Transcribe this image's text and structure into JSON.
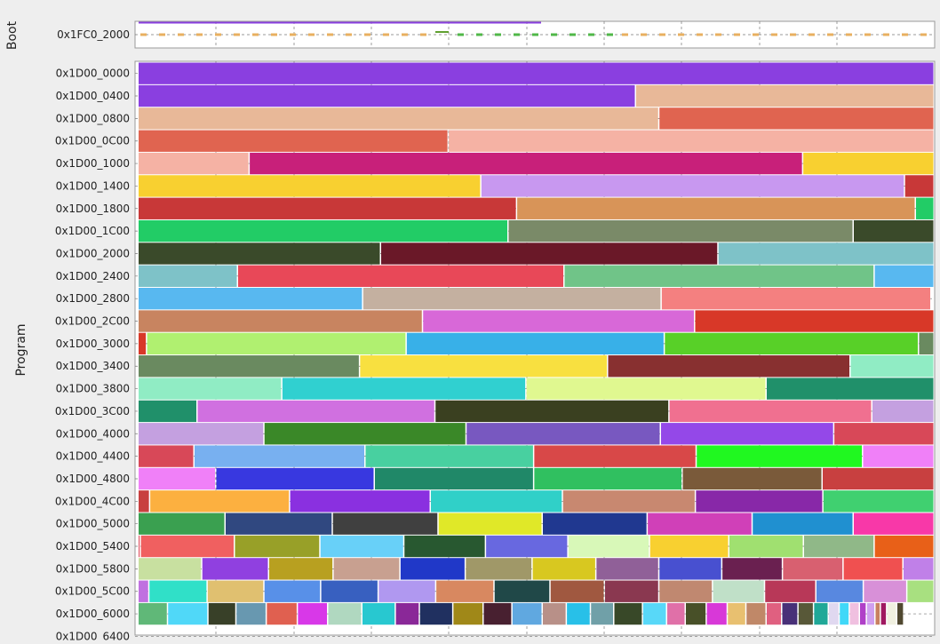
{
  "chart_data": {
    "type": "memory-map",
    "groups": [
      {
        "name": "Boot",
        "rows": [
          "0x1FC0_2000"
        ]
      },
      {
        "name": "Program",
        "rows": [
          "0x1D00_0000",
          "0x1D00_0400",
          "0x1D00_0800",
          "0x1D00_0C00",
          "0x1D00_1000",
          "0x1D00_1400",
          "0x1D00_1800",
          "0x1D00_1C00",
          "0x1D00_2000",
          "0x1D00_2400",
          "0x1D00_2800",
          "0x1D00_2C00",
          "0x1D00_3000",
          "0x1D00_3400",
          "0x1D00_3800",
          "0x1D00_3C00",
          "0x1D00_4000",
          "0x1D00_4400",
          "0x1D00_4800",
          "0x1D00_4C00",
          "0x1D00_5000",
          "0x1D00_5400",
          "0x1D00_5800",
          "0x1D00_5C00",
          "0x1D00_6000",
          "0x1D00_6400"
        ]
      }
    ],
    "row_span": 1024,
    "xlim": [
      0,
      1024
    ],
    "grid": true,
    "segments": [
      [
        [
          0,
          1024,
          "#8a3fe0"
        ]
      ],
      [
        [
          0,
          640,
          "#8a3fe0"
        ],
        [
          640,
          1024,
          "#e8b898"
        ]
      ],
      [
        [
          0,
          670,
          "#e8b898"
        ],
        [
          670,
          1024,
          "#e06450"
        ]
      ],
      [
        [
          0,
          399,
          "#e06450"
        ],
        [
          399,
          1024,
          "#f5b2a4"
        ]
      ],
      [
        [
          0,
          143,
          "#f5b2a4"
        ],
        [
          143,
          855,
          "#c8207a"
        ],
        [
          855,
          1024,
          "#f8d030"
        ]
      ],
      [
        [
          0,
          441,
          "#f8d030"
        ],
        [
          441,
          986,
          "#c898f0"
        ],
        [
          986,
          1024,
          "#c83838"
        ]
      ],
      [
        [
          0,
          487,
          "#c83838"
        ],
        [
          487,
          1000,
          "#d89458"
        ],
        [
          1000,
          1024,
          "#22cc66"
        ]
      ],
      [
        [
          0,
          476,
          "#22cc66"
        ],
        [
          476,
          920,
          "#7a8a68"
        ],
        [
          920,
          1024,
          "#3a4a2a"
        ]
      ],
      [
        [
          0,
          312,
          "#3a4a2a"
        ],
        [
          312,
          746,
          "#6a1828"
        ],
        [
          746,
          1024,
          "#7ec2c8"
        ]
      ],
      [
        [
          0,
          128,
          "#7ec2c8"
        ],
        [
          128,
          548,
          "#e84858"
        ],
        [
          548,
          947,
          "#70c488"
        ],
        [
          947,
          1024,
          "#58b8f0"
        ]
      ],
      [
        [
          0,
          289,
          "#58b8f0"
        ],
        [
          289,
          673,
          "#c4b0a0"
        ],
        [
          673,
          1020,
          "#f48080"
        ]
      ],
      [
        [
          0,
          366,
          "#c88460"
        ],
        [
          366,
          716,
          "#d868d8"
        ],
        [
          716,
          1024,
          "#d83828"
        ]
      ],
      [
        [
          0,
          11,
          "#d83828"
        ],
        [
          11,
          345,
          "#b0f070"
        ],
        [
          345,
          677,
          "#38b0e8"
        ],
        [
          677,
          1004,
          "#58d028"
        ],
        [
          1004,
          1024,
          "#6a8a60"
        ]
      ],
      [
        [
          0,
          285,
          "#6a8a60"
        ],
        [
          285,
          604,
          "#f8e040"
        ],
        [
          604,
          916,
          "#883030"
        ],
        [
          916,
          1024,
          "#90ecc4"
        ]
      ],
      [
        [
          0,
          185,
          "#90ecc4"
        ],
        [
          185,
          499,
          "#30d0d0"
        ],
        [
          499,
          808,
          "#e0f890"
        ],
        [
          808,
          1024,
          "#20906a"
        ]
      ],
      [
        [
          0,
          76,
          "#20906a"
        ],
        [
          76,
          382,
          "#d070e0"
        ],
        [
          382,
          683,
          "#3a4020"
        ],
        [
          683,
          944,
          "#f07090"
        ],
        [
          944,
          1024,
          "#c4a0e0"
        ]
      ],
      [
        [
          0,
          162,
          "#c4a0e0"
        ],
        [
          162,
          422,
          "#3a8828"
        ],
        [
          422,
          672,
          "#7858c0"
        ],
        [
          672,
          895,
          "#9448e8"
        ],
        [
          895,
          1024,
          "#d84858"
        ]
      ],
      [
        [
          0,
          72,
          "#d84858"
        ],
        [
          72,
          292,
          "#78b0f0"
        ],
        [
          292,
          509,
          "#48d0a0"
        ],
        [
          509,
          718,
          "#d84848"
        ],
        [
          718,
          932,
          "#20f820"
        ],
        [
          932,
          1024,
          "#f080f8"
        ]
      ],
      [
        [
          0,
          100,
          "#f080f8"
        ],
        [
          100,
          304,
          "#3838e0"
        ],
        [
          304,
          509,
          "#208868"
        ],
        [
          509,
          700,
          "#30c060"
        ],
        [
          700,
          880,
          "#7a5a3a"
        ],
        [
          880,
          1024,
          "#c84040"
        ]
      ],
      [
        [
          0,
          15,
          "#c84040"
        ],
        [
          15,
          195,
          "#fcb040"
        ],
        [
          195,
          376,
          "#8a30e0"
        ],
        [
          376,
          546,
          "#30d0c8"
        ],
        [
          546,
          717,
          "#c88870"
        ],
        [
          717,
          881,
          "#8828a8"
        ],
        [
          881,
          1024,
          "#40d070"
        ]
      ],
      [
        [
          0,
          112,
          "#3aa050"
        ],
        [
          112,
          250,
          "#304880"
        ],
        [
          250,
          386,
          "#404040"
        ],
        [
          386,
          520,
          "#e0e828"
        ],
        [
          520,
          655,
          "#203890"
        ],
        [
          655,
          790,
          "#d040b8"
        ],
        [
          790,
          920,
          "#2090d0"
        ],
        [
          920,
          1024,
          "#f838a8"
        ]
      ],
      [
        [
          0,
          3,
          "#e05060"
        ],
        [
          3,
          124,
          "#f06060"
        ],
        [
          124,
          234,
          "#98a028"
        ],
        [
          234,
          342,
          "#68d0f8"
        ],
        [
          342,
          447,
          "#285830"
        ],
        [
          447,
          553,
          "#6868e0"
        ],
        [
          553,
          658,
          "#d8f8b8"
        ],
        [
          658,
          760,
          "#f8d030"
        ],
        [
          760,
          856,
          "#a0e070"
        ],
        [
          856,
          947,
          "#90b888"
        ],
        [
          947,
          1024,
          "#e86018"
        ]
      ],
      [
        [
          0,
          82,
          "#c8e0a0"
        ],
        [
          82,
          168,
          "#9040e0"
        ],
        [
          168,
          251,
          "#b8a020"
        ],
        [
          251,
          337,
          "#c8a090"
        ],
        [
          337,
          421,
          "#2038c8"
        ],
        [
          421,
          507,
          "#a09868"
        ],
        [
          507,
          589,
          "#d8c820"
        ],
        [
          589,
          670,
          "#906098"
        ],
        [
          670,
          751,
          "#4850d0"
        ],
        [
          751,
          829,
          "#6a2050"
        ],
        [
          829,
          907,
          "#d86070"
        ],
        [
          907,
          984,
          "#f05050"
        ],
        [
          984,
          1024,
          "#c080e8"
        ]
      ],
      [
        [
          0,
          14,
          "#c070e0"
        ],
        [
          14,
          89,
          "#30e0c8"
        ],
        [
          89,
          162,
          "#e0c070"
        ],
        [
          162,
          235,
          "#5890e8"
        ],
        [
          235,
          309,
          "#3860c0"
        ],
        [
          309,
          383,
          "#b098f0"
        ],
        [
          383,
          458,
          "#d88860"
        ],
        [
          458,
          530,
          "#204848"
        ],
        [
          530,
          600,
          "#a05840"
        ],
        [
          600,
          670,
          "#8a3850"
        ],
        [
          670,
          739,
          "#c08870"
        ],
        [
          739,
          806,
          "#c0e0c8"
        ],
        [
          806,
          872,
          "#b83858"
        ],
        [
          872,
          933,
          "#5888e0"
        ],
        [
          933,
          989,
          "#d890d8"
        ],
        [
          989,
          1024,
          "#a8e080"
        ]
      ],
      [
        [
          0,
          38,
          "#60b878"
        ],
        [
          38,
          90,
          "#50d8f8"
        ],
        [
          90,
          126,
          "#384028"
        ],
        [
          126,
          165,
          "#6898b0"
        ],
        [
          165,
          205,
          "#e06050"
        ],
        [
          205,
          244,
          "#d838e8"
        ],
        [
          244,
          288,
          "#b0d8c0"
        ],
        [
          288,
          331,
          "#28c8d0"
        ],
        [
          331,
          362,
          "#8a2898"
        ],
        [
          362,
          405,
          "#203060"
        ],
        [
          405,
          444,
          "#a08818"
        ],
        [
          444,
          481,
          "#482030"
        ],
        [
          481,
          520,
          "#60a8e0"
        ],
        [
          520,
          551,
          "#b89088"
        ],
        [
          551,
          582,
          "#28c0e8"
        ],
        [
          582,
          612,
          "#70a0a8"
        ],
        [
          612,
          649,
          "#384828"
        ],
        [
          649,
          680,
          "#58d8f8"
        ],
        [
          680,
          704,
          "#e070a8"
        ],
        [
          704,
          731,
          "#485028"
        ],
        [
          731,
          758,
          "#d838d8"
        ],
        [
          758,
          782,
          "#e8c070"
        ],
        [
          782,
          808,
          "#c08868"
        ],
        [
          808,
          828,
          "#e06080"
        ],
        [
          828,
          849,
          "#483078"
        ],
        [
          849,
          869,
          "#585838"
        ],
        [
          869,
          888,
          "#20a898"
        ],
        [
          888,
          902,
          "#e0d8f0"
        ],
        [
          902,
          915,
          "#40d8f8"
        ],
        [
          915,
          928,
          "#f0c0e0"
        ],
        [
          928,
          937,
          "#b040c8"
        ],
        [
          937,
          948,
          "#d0a0f0"
        ],
        [
          948,
          955,
          "#c88060"
        ],
        [
          955,
          963,
          "#a01860"
        ],
        [
          963,
          976,
          "#f0f0e0"
        ],
        [
          976,
          985,
          "#504830"
        ]
      ],
      []
    ]
  }
}
